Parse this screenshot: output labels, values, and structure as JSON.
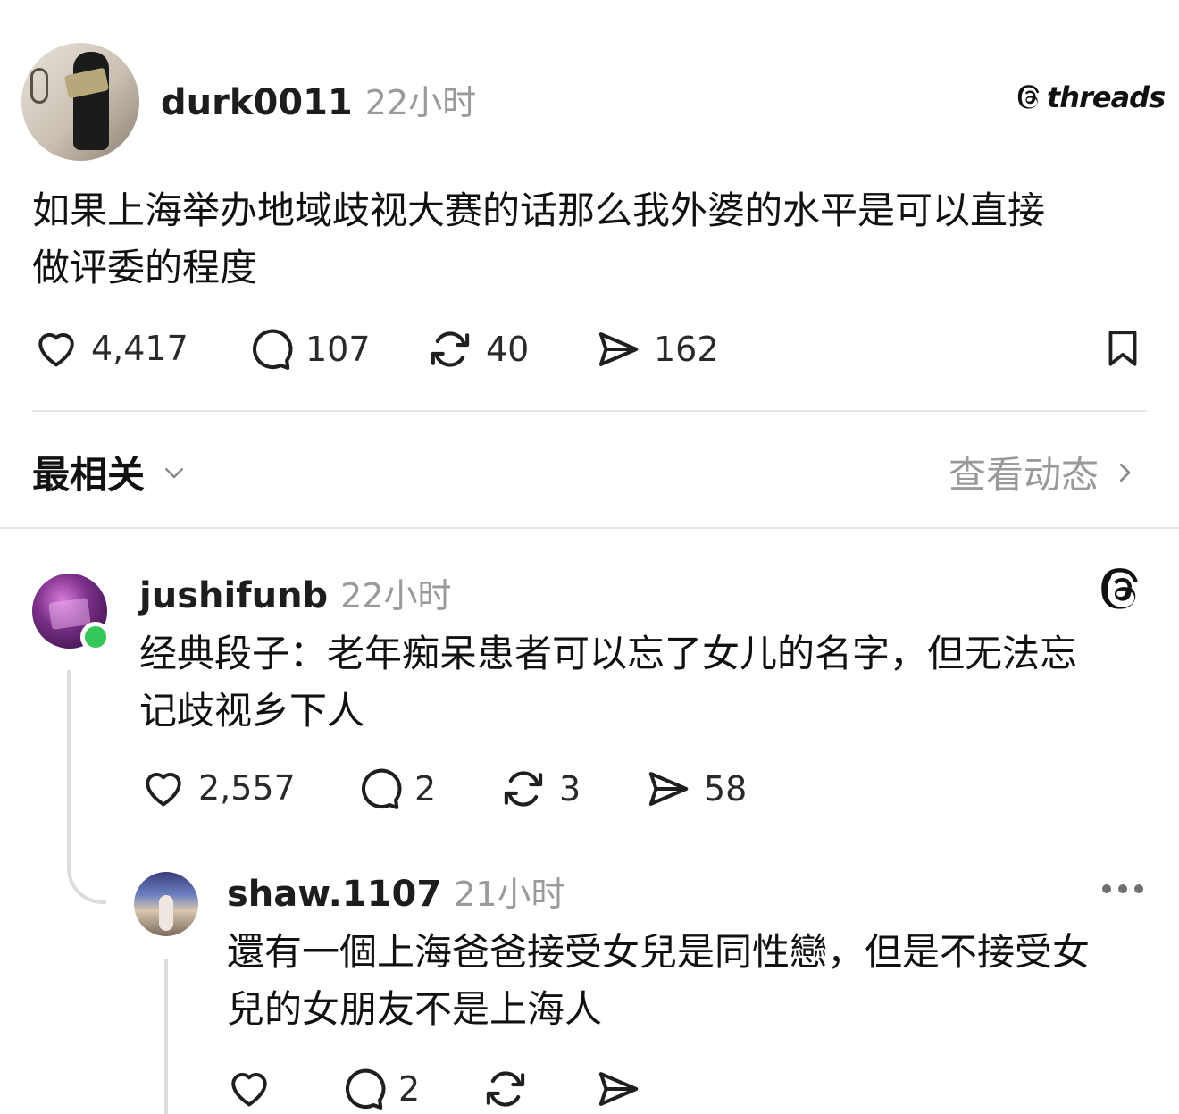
{
  "post": {
    "username": "durk0011",
    "time": "22小时",
    "brand": "threads",
    "text_line1": "如果上海举办地域歧视大赛的话那么我外婆的水平是可以直接",
    "text_line2": "做评委的程度",
    "likes": "4,417",
    "comments": "107",
    "reposts": "40",
    "shares": "162"
  },
  "sort": {
    "label": "最相关",
    "activity_label": "查看动态"
  },
  "reply1": {
    "username": "jushifunb",
    "time": "22小时",
    "text_line1": "经典段子：老年痴呆患者可以忘了女儿的名字，但无法忘",
    "text_line2": "记歧视乡下人",
    "likes": "2,557",
    "comments": "2",
    "reposts": "3",
    "shares": "58"
  },
  "reply2": {
    "username": "shaw.1107",
    "time": "21小时",
    "text_line1": "還有一個上海爸爸接受女兒是同性戀，但是不接受女",
    "text_line2": "兒的女朋友不是上海人",
    "comments": "2"
  },
  "colors": {
    "online_status": "#35c759",
    "muted_text": "#9a9a9a",
    "divider": "#e4e4e4"
  },
  "icons": [
    "heart-icon",
    "comment-icon",
    "repost-icon",
    "share-icon",
    "bookmark-icon",
    "chevron-down-icon",
    "chevron-right-icon",
    "threads-logo-icon",
    "more-icon"
  ]
}
